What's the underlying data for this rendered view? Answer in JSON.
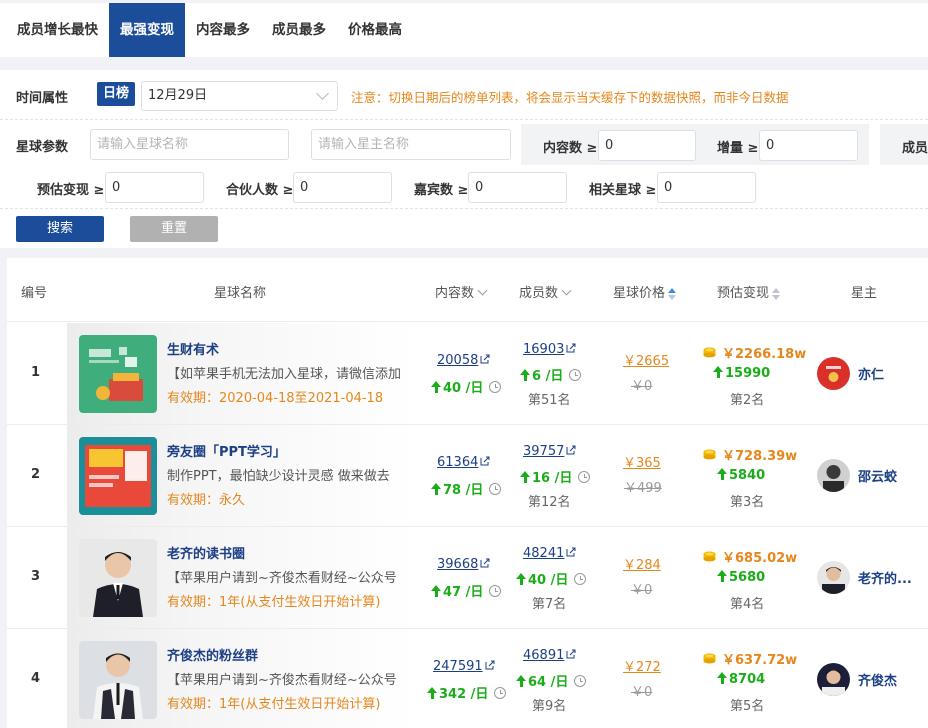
{
  "tabs": [
    "成员增长最快",
    "最强变现",
    "内容最多",
    "成员最多",
    "价格最高"
  ],
  "active_tab": 1,
  "filters": {
    "time_label": "时间属性",
    "day_badge": "日榜",
    "date_value": "12月29日",
    "notice": "注意：切换日期后的榜单列表，将会显示当天缓存下的数据快照，而非今日数据",
    "param_label": "星球参数",
    "planet_placeholder": "请输入星球名称",
    "owner_placeholder": "请输入星主名称",
    "content_label": "内容数 ≥",
    "content_value": "0",
    "increase_label": "增量 ≥",
    "increase_value": "0",
    "member_label": "成员",
    "estimate_label": "预估变现 ≥",
    "estimate_value": "0",
    "partner_label": "合伙人数 ≥",
    "partner_value": "0",
    "guest_label": "嘉宾数 ≥",
    "guest_value": "0",
    "related_label": "相关星球 ≥",
    "related_value": "0",
    "search_button": "搜索",
    "reset_button": "重置"
  },
  "table": {
    "headers": {
      "no": "编号",
      "name": "星球名称",
      "content": "内容数",
      "members": "成员数",
      "price": "星球价格",
      "estimate": "预估变现",
      "owner": "星主"
    },
    "rows": [
      {
        "no": "1",
        "name": "生财有术",
        "desc": "【如苹果手机无法加入星球，请微信添加",
        "validity": "有效期：2020-04-18至2021-04-18",
        "content": "20058",
        "content_growth": "40 /日",
        "members": "16903",
        "members_growth": "6 /日",
        "members_rank": "第51名",
        "price": "￥2665",
        "old_price": "￥0",
        "estimate": "￥2266.18w",
        "estimate_growth": "15990",
        "estimate_rank": "第2名",
        "owner": "亦仁"
      },
      {
        "no": "2",
        "name": "旁友圈「PPT学习」",
        "desc": "制作PPT，最怕缺少设计灵感 做来做去",
        "validity": "有效期：永久",
        "content": "61364",
        "content_growth": "78 /日",
        "members": "39757",
        "members_growth": "16 /日",
        "members_rank": "第12名",
        "price": "￥365",
        "old_price": "￥499",
        "estimate": "￥728.39w",
        "estimate_growth": "5840",
        "estimate_rank": "第3名",
        "owner": "邵云蛟"
      },
      {
        "no": "3",
        "name": "老齐的读书圈",
        "desc": "【苹果用户请到~齐俊杰看财经~公众号",
        "validity": "有效期：1年(从支付生效日开始计算)",
        "content": "39668",
        "content_growth": "47 /日",
        "members": "48241",
        "members_growth": "40 /日",
        "members_rank": "第7名",
        "price": "￥284",
        "old_price": "￥0",
        "estimate": "￥685.02w",
        "estimate_growth": "5680",
        "estimate_rank": "第4名",
        "owner": "老齐的..."
      },
      {
        "no": "4",
        "name": "齐俊杰的粉丝群",
        "desc": "【苹果用户请到~齐俊杰看财经~公众号",
        "validity": "有效期：1年(从支付生效日开始计算)",
        "content": "247591",
        "content_growth": "342 /日",
        "members": "46891",
        "members_growth": "64 /日",
        "members_rank": "第9名",
        "price": "￥272",
        "old_price": "￥0",
        "estimate": "￥637.72w",
        "estimate_growth": "8704",
        "estimate_rank": "第5名",
        "owner": "齐俊杰"
      }
    ]
  },
  "colors": {
    "brand_blue": "#1c4d9a",
    "link_blue": "#1c3f86",
    "orange": "#e6871c",
    "green": "#1aad19",
    "grey_button": "#b1b1b1"
  }
}
